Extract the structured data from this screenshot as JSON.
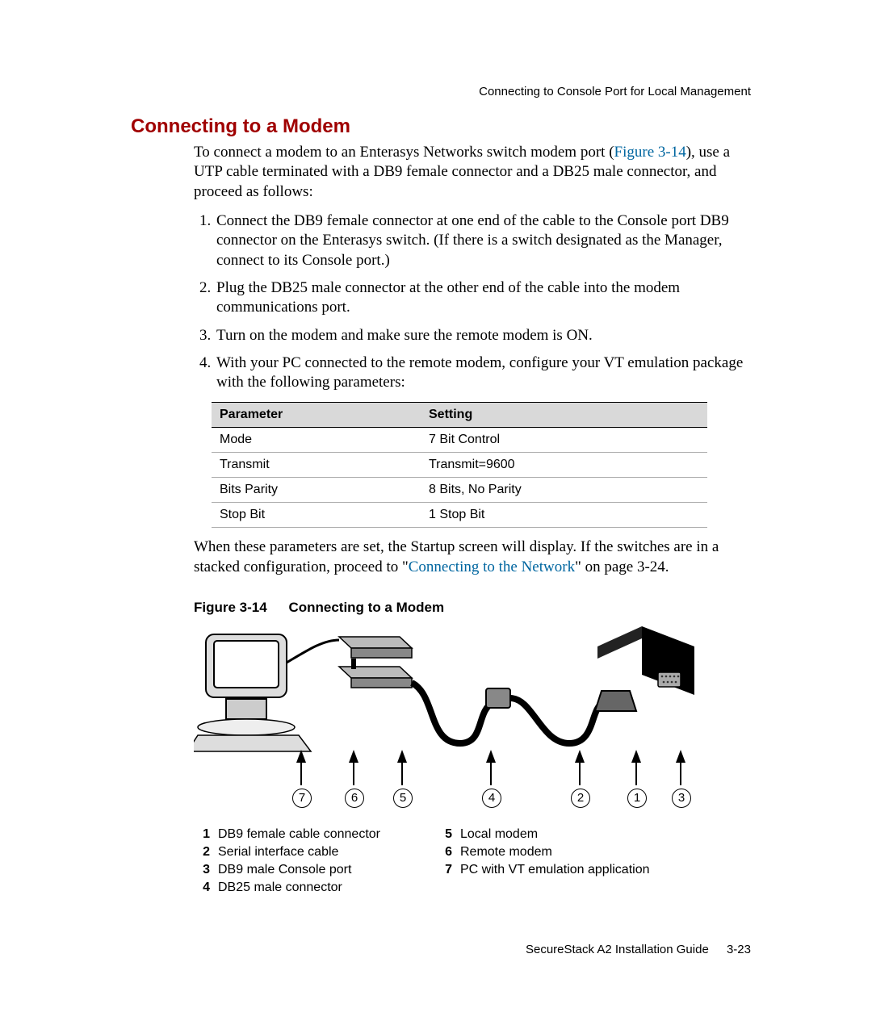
{
  "running_header": "Connecting to Console Port for Local Management",
  "heading": "Connecting to a Modem",
  "intro_pre": "To connect a modem to an Enterasys Networks switch modem port (",
  "intro_link": "Figure 3-14",
  "intro_post": "), use a UTP cable terminated with a DB9 female connector and a DB25 male connector, and proceed as follows:",
  "steps": [
    "Connect the DB9 female connector at one end of the cable to the Console port DB9 connector on the Enterasys switch. (If there is a switch designated as the Manager, connect to its Console port.)",
    "Plug the DB25 male connector at the other end of the cable into the modem communications port.",
    "Turn on the modem and make sure the remote modem is ON.",
    "With your PC connected to the remote modem, configure your VT emulation package with the following parameters:"
  ],
  "table": {
    "headers": [
      "Parameter",
      "Setting"
    ],
    "rows": [
      [
        "Mode",
        "7 Bit Control"
      ],
      [
        "Transmit",
        "Transmit=9600"
      ],
      [
        "Bits Parity",
        "8 Bits, No Parity"
      ],
      [
        "Stop Bit",
        "1 Stop Bit"
      ]
    ]
  },
  "after_table_pre": "When these parameters are set, the Startup screen will display. If the switches are in a stacked configuration, proceed to \"",
  "after_table_link": "Connecting to the Network",
  "after_table_post": "\" on page 3-24.",
  "figure_label": "Figure 3-14",
  "figure_title": "Connecting to a Modem",
  "callouts_order": [
    "7",
    "6",
    "5",
    "4",
    "2",
    "1",
    "3"
  ],
  "legend_left": [
    {
      "n": "1",
      "t": "DB9 female cable connector"
    },
    {
      "n": "2",
      "t": "Serial interface cable"
    },
    {
      "n": "3",
      "t": "DB9 male Console port"
    },
    {
      "n": "4",
      "t": "DB25 male connector"
    }
  ],
  "legend_right": [
    {
      "n": "5",
      "t": "Local modem"
    },
    {
      "n": "6",
      "t": "Remote modem"
    },
    {
      "n": "7",
      "t": "PC with VT emulation application"
    }
  ],
  "footer_doc": "SecureStack A2 Installation Guide",
  "footer_page": "3-23"
}
